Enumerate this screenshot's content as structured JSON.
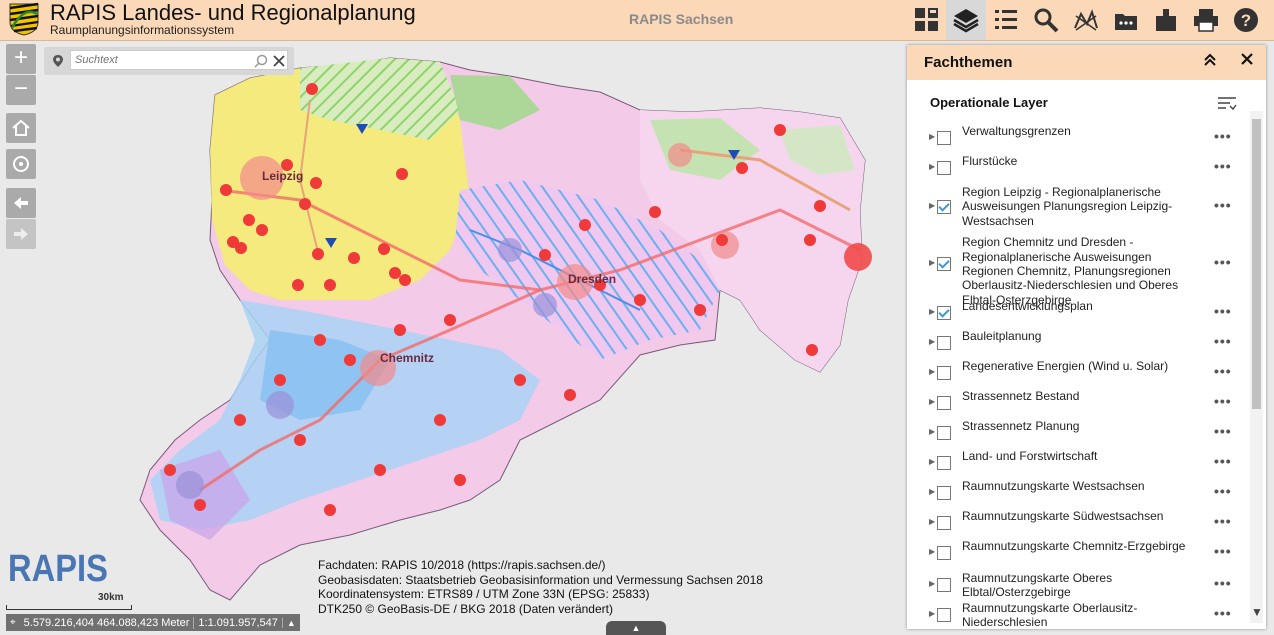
{
  "header": {
    "title": "RAPIS Landes- und Regionalplanung",
    "subtitle": "Raumplanungsinformationssystem",
    "center_title": "RAPIS Sachsen",
    "toolbar": [
      {
        "icon": "widgets-grid-icon"
      },
      {
        "icon": "layers-icon"
      },
      {
        "icon": "legend-list-icon"
      },
      {
        "icon": "search-icon"
      },
      {
        "icon": "measure-tool-icon"
      },
      {
        "icon": "more-tools-icon"
      },
      {
        "icon": "bookmark-icon"
      },
      {
        "icon": "print-icon"
      },
      {
        "icon": "help-icon"
      }
    ]
  },
  "map": {
    "zoom_in": "+",
    "zoom_out": "−",
    "search_placeholder": "Suchtext",
    "logo_text": "RAPIS",
    "scale_label": "30km",
    "coordinates": "5.579.216,404 464.088,423 Meter",
    "scale": "1:1.091.957,547",
    "city_labels": [
      "Leipzig",
      "Dresden",
      "Chemnitz"
    ],
    "credits": [
      "Fachdaten: RAPIS 10/2018 (https://rapis.sachsen.de/)",
      "Geobasisdaten: Staatsbetrieb Geobasisinformation und Vermessung Sachsen 2018",
      "Koordinatensystem: ETRS89 / UTM Zone 33N (EPSG: 25833)",
      "DTK250 © GeoBasis-DE / BKG 2018 (Daten verändert)"
    ]
  },
  "panel": {
    "title": "Fachthemen",
    "heading": "Operationale Layer",
    "layers": [
      {
        "label": "Verwaltungsgrenzen",
        "checked": false
      },
      {
        "label": "Flurstücke",
        "checked": false
      },
      {
        "label": "Region Leipzig - Regionalplanerische Ausweisungen Planungsregion Leipzig-Westsachsen",
        "checked": true
      },
      {
        "label": "Region Chemnitz und Dresden - Regionalplanerische Ausweisungen Regionen Chemnitz, Planungsregionen Oberlausitz-Niederschlesien und Oberes Elbtal-Osterzgebirge",
        "checked": true
      },
      {
        "label": "Landesentwicklungsplan",
        "checked": true
      },
      {
        "label": "Bauleitplanung",
        "checked": false
      },
      {
        "label": "Regenerative Energien (Wind u. Solar)",
        "checked": false
      },
      {
        "label": "Strassennetz Bestand",
        "checked": false
      },
      {
        "label": "Strassennetz Planung",
        "checked": false
      },
      {
        "label": "Land- und Forstwirtschaft",
        "checked": false
      },
      {
        "label": "Raumnutzungskarte Westsachsen",
        "checked": false
      },
      {
        "label": "Raumnutzungskarte Südwestsachsen",
        "checked": false
      },
      {
        "label": "Raumnutzungskarte Chemnitz-Erzgebirge",
        "checked": false
      },
      {
        "label": "Raumnutzungskarte Oberes Elbtal/Osterzgebirge",
        "checked": false
      },
      {
        "label": "Raumnutzungskarte Oberlausitz-Niederschlesien",
        "checked": false
      }
    ],
    "more_label": "•••"
  },
  "colors": {
    "header_bg": "#fbd8b8",
    "accent_blue": "#4a76b3",
    "checkbox_check": "#3a9ad9"
  }
}
